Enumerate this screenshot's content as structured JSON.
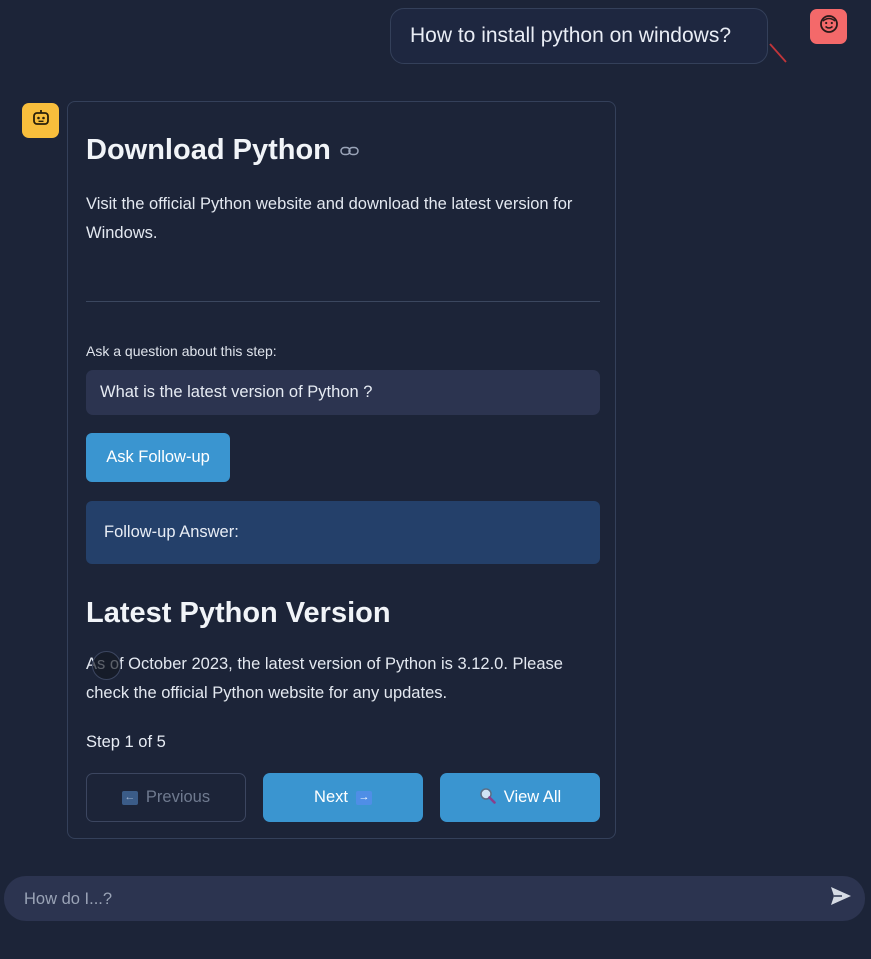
{
  "user_message": {
    "text": "How to install python on windows?"
  },
  "step_card": {
    "title": "Download Python",
    "description": "Visit the official Python website and download the latest version for Windows.",
    "ask_label": "Ask a question about this step:",
    "ask_input_value": "What is the latest version of Python ?",
    "followup_button": "Ask Follow-up",
    "followup_answer_label": "Follow-up Answer:",
    "answer_title": "Latest Python Version",
    "answer_text": "As of October 2023, the latest version of Python is 3.12.0. Please check the official Python website for any updates.",
    "step_counter": "Step 1 of 5",
    "prev_label": "Previous",
    "next_label": "Next",
    "view_all_label": "View All"
  },
  "chat_input": {
    "placeholder": "How do I...?"
  },
  "colors": {
    "background": "#1c2438",
    "accent": "#3a95d0",
    "user_avatar": "#f4696a",
    "bot_avatar": "#f8be3c",
    "answer_box": "#24406a"
  },
  "icons": {
    "user_avatar": "face-icon",
    "bot_avatar": "robot-icon",
    "title_link": "link-icon",
    "prev": "left-arrow-icon",
    "next": "right-arrow-icon",
    "view_all": "magnifier-icon",
    "send": "send-icon"
  }
}
